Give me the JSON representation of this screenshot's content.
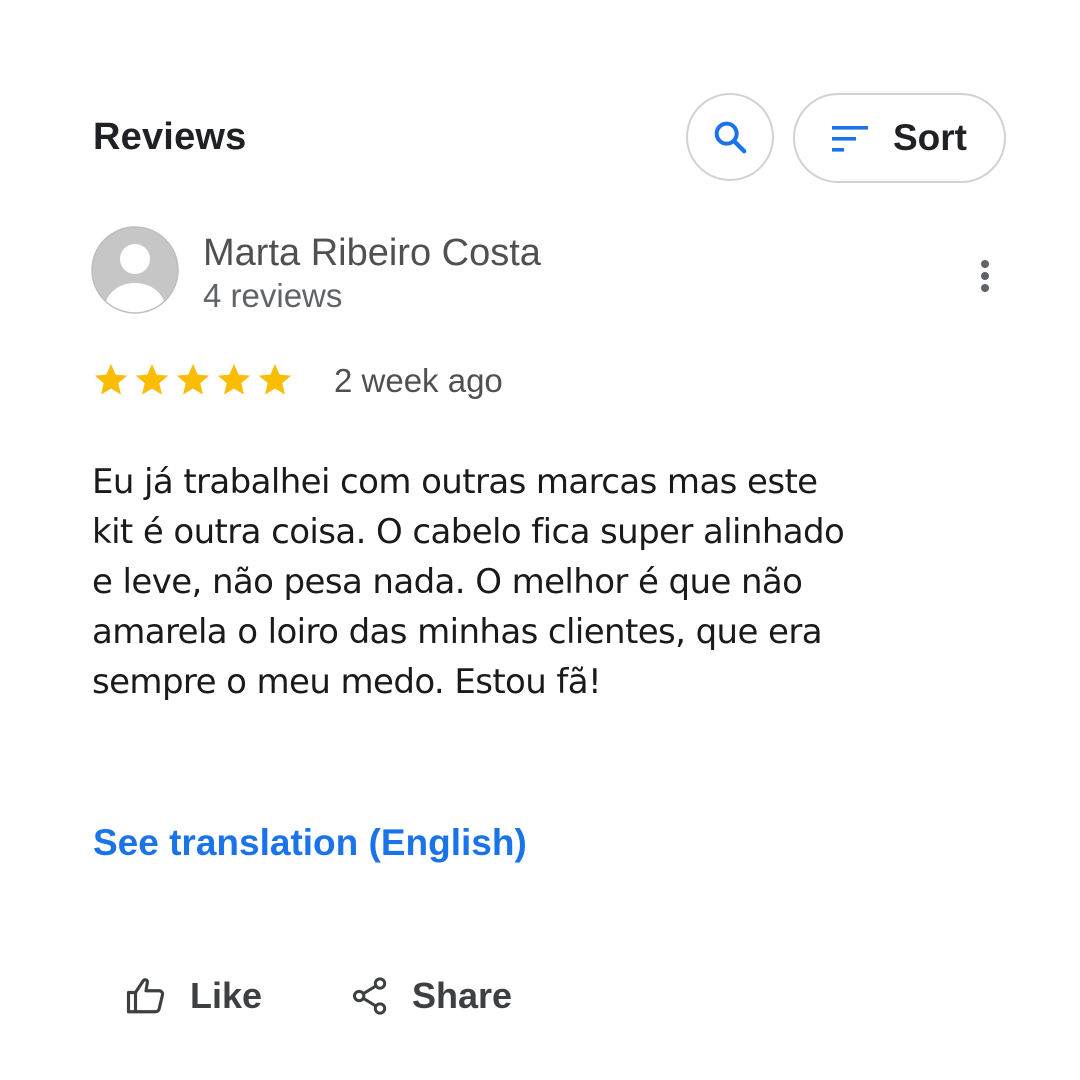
{
  "header": {
    "title": "Reviews",
    "sort_label": "Sort"
  },
  "review": {
    "reviewer_name": "Marta Ribeiro Costa",
    "reviewer_count": "4 reviews",
    "rating": 5,
    "rating_max": 5,
    "date": "2 week ago",
    "text": "Eu já trabalhei com outras marcas mas este kit é outra coisa. O cabelo fica super alinhado e leve, não pesa nada. O melhor é que não amarela o loiro das minhas clientes, que era sempre o meu medo. Estou fã!",
    "see_translation": "See translation (English)"
  },
  "actions": {
    "like_label": "Like",
    "share_label": "Share"
  },
  "icons": {
    "search": "search-icon",
    "sort": "sort-icon",
    "more": "more-vert-icon",
    "star": "star-icon",
    "like": "thumb-up-icon",
    "share": "share-icon",
    "avatar": "avatar-icon"
  },
  "colors": {
    "accent": "#1a73e8",
    "star": "#fbbc04",
    "border": "#d2d2d2",
    "avatar_bg": "#c4c4c4"
  }
}
